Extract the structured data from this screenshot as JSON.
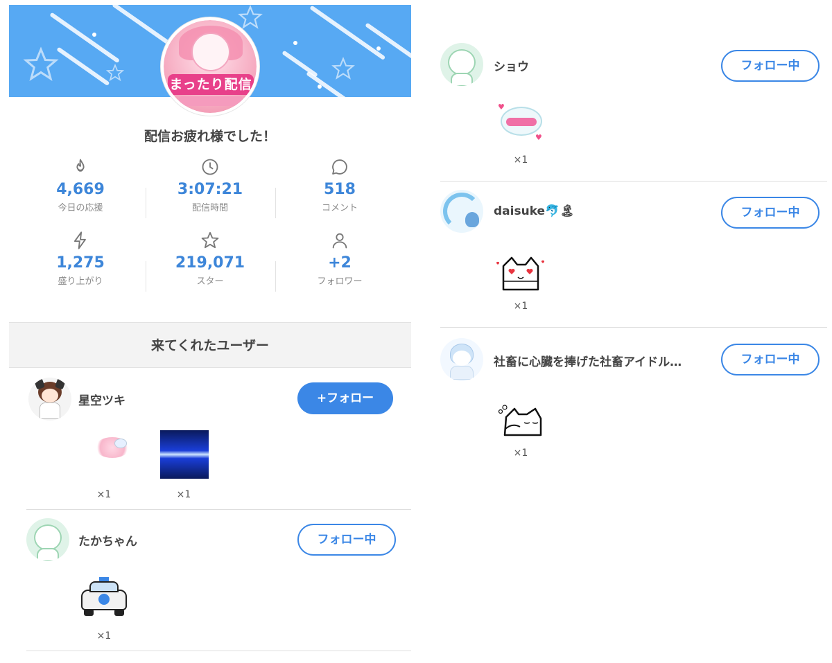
{
  "summary": {
    "title": "配信お疲れ様でした！",
    "stats": [
      {
        "icon": "flame-icon",
        "value": "4,669",
        "label": "今日の応援"
      },
      {
        "icon": "clock-icon",
        "value": "3:07:21",
        "label": "配信時間"
      },
      {
        "icon": "comment-icon",
        "value": "518",
        "label": "コメント"
      },
      {
        "icon": "lightning-icon",
        "value": "1,275",
        "label": "盛り上がり"
      },
      {
        "icon": "star-icon",
        "value": "219,071",
        "label": "スター"
      },
      {
        "icon": "person-icon",
        "value": "+2",
        "label": "フォロワー"
      }
    ]
  },
  "banner": {
    "color": "#57a9f3",
    "avatar_logo_text": "まったり配信"
  },
  "visited": {
    "heading": "来てくれたユーザー",
    "users": [
      {
        "name": "星空ツキ",
        "button": "+フォロー",
        "state": "follow",
        "gifts": [
          {
            "icon": "flower-gift-icon",
            "qty": "×1"
          },
          {
            "icon": "light-beam-gift-icon",
            "qty": "×1"
          }
        ]
      },
      {
        "name": "たかちゃん",
        "button": "フォロー中",
        "state": "following",
        "gifts": [
          {
            "icon": "police-car-gift-icon",
            "qty": "×1"
          }
        ]
      },
      {
        "name": "ショウ",
        "button": "フォロー中",
        "state": "following",
        "gifts": [
          {
            "icon": "kawaii-sticker-gift-icon",
            "qty": "×1"
          }
        ]
      },
      {
        "name": "daisuke🐬🏝",
        "button": "フォロー中",
        "state": "following",
        "gifts": [
          {
            "icon": "heart-eyes-cat-gift-icon",
            "qty": "×1"
          }
        ]
      },
      {
        "name": "社畜に心臓を捧げた社畜アイドル…",
        "button": "フォロー中",
        "state": "following",
        "gifts": [
          {
            "icon": "sleepy-cat-gift-icon",
            "qty": "×1"
          }
        ]
      }
    ]
  },
  "colors": {
    "accent": "#3b87e6",
    "stat_value": "#3d86d9"
  }
}
